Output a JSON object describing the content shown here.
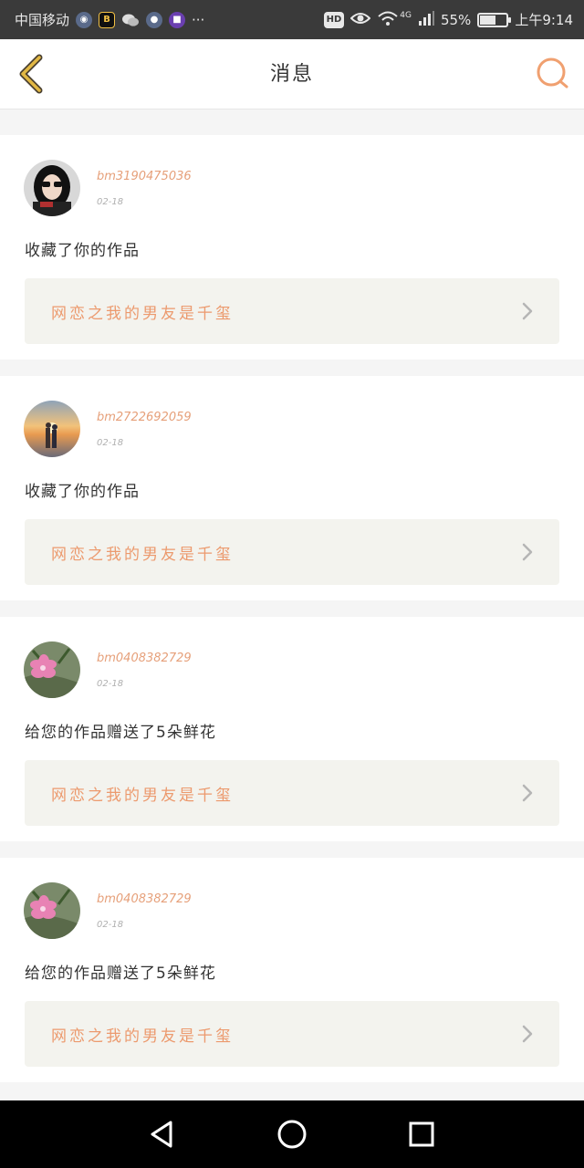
{
  "status_bar": {
    "carrier": "中国移动",
    "more_dots": "···",
    "network": "4G",
    "battery_percent": "55%",
    "battery_level": 0.55,
    "time": "上午9:14",
    "icons": [
      "notification-icon",
      "bilibili-icon",
      "wechat-icon",
      "app-icon",
      "app-icon-2",
      "hd-icon",
      "eye-icon",
      "wifi-icon",
      "signal-icon",
      "battery-icon"
    ]
  },
  "header": {
    "title": "消息",
    "back_icon": "chevron-left-icon",
    "search_icon": "search-icon"
  },
  "colors": {
    "accent": "#e6a07a",
    "link_text": "#ec9a6e",
    "back_arrow": "#e2b844",
    "search_ring": "#f0a070",
    "card_link_bg": "#f3f3ee"
  },
  "messages": [
    {
      "username": "bm3190475036",
      "date": "02-18",
      "action": "收藏了你的作品",
      "work_title": "网恋之我的男友是千玺",
      "avatar": "avatar-woman-glasses"
    },
    {
      "username": "bm2722692059",
      "date": "02-18",
      "action": "收藏了你的作品",
      "work_title": "网恋之我的男友是千玺",
      "avatar": "avatar-sunset-couple"
    },
    {
      "username": "bm0408382729",
      "date": "02-18",
      "action": "给您的作品赠送了5朵鲜花",
      "work_title": "网恋之我的男友是千玺",
      "avatar": "avatar-pink-flower"
    },
    {
      "username": "bm0408382729",
      "date": "02-18",
      "action": "给您的作品赠送了5朵鲜花",
      "work_title": "网恋之我的男友是千玺",
      "avatar": "avatar-pink-flower"
    }
  ],
  "nav_bar": {
    "buttons": [
      "back-triangle-icon",
      "home-circle-icon",
      "recents-square-icon"
    ]
  }
}
